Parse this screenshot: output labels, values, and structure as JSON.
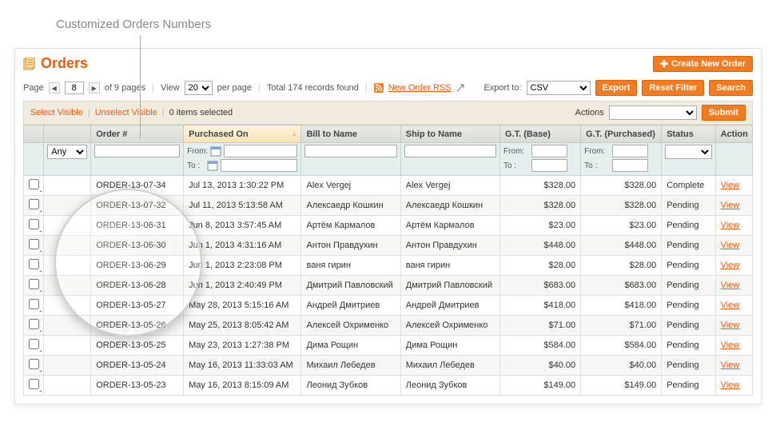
{
  "callout": "Customized Orders Numbers",
  "header": {
    "title": "Orders",
    "create_btn": "Create New Order"
  },
  "toolbar": {
    "page_label": "Page",
    "page_value": "8",
    "of_pages": "of 9 pages",
    "view_label": "View",
    "view_value": "20",
    "per_page": "per page",
    "total": "Total 174 records found",
    "rss": "New Order RSS",
    "export_label": "Export to:",
    "export_value": "CSV",
    "export_btn": "Export",
    "reset_btn": "Reset Filter",
    "search_btn": "Search"
  },
  "selectbar": {
    "select_visible": "Select Visible",
    "unselect_visible": "Unselect Visible",
    "items_selected": "0 items selected",
    "actions_label": "Actions",
    "submit": "Submit"
  },
  "columns": {
    "order_no": "Order #",
    "purchased_on": "Purchased On",
    "bill_to": "Bill to Name",
    "ship_to": "Ship to Name",
    "gt_base": "G.T. (Base)",
    "gt_purchased": "G.T. (Purchased)",
    "status": "Status",
    "action": "Action"
  },
  "filters": {
    "any": "Any",
    "from": "From:",
    "to": "To :"
  },
  "rows": [
    {
      "order": "ORDER-13-07-34",
      "date": "Jul 13, 2013 1:30:22 PM",
      "bill": "Alex Vergej",
      "ship": "Alex Vergej",
      "base": "$328.00",
      "purch": "$328.00",
      "status": "Complete"
    },
    {
      "order": "ORDER-13-07-32",
      "date": "Jul 11, 2013 5:13:58 AM",
      "bill": "Алексаедр Кошкин",
      "ship": "Алексаедр Кошкин",
      "base": "$328.00",
      "purch": "$328.00",
      "status": "Pending"
    },
    {
      "order": "ORDER-13-06-31",
      "date": "Jun 8, 2013 3:57:45 AM",
      "bill": "Артём Кармалов",
      "ship": "Артём Кармалов",
      "base": "$23.00",
      "purch": "$23.00",
      "status": "Pending"
    },
    {
      "order": "ORDER-13-06-30",
      "date": "Jun 1, 2013 4:31:16 AM",
      "bill": "Антон Правдухин",
      "ship": "Антон Правдухин",
      "base": "$448.00",
      "purch": "$448.00",
      "status": "Pending"
    },
    {
      "order": "ORDER-13-06-29",
      "date": "Jun 1, 2013 2:23:08 PM",
      "bill": "ваня гирин",
      "ship": "ваня гирин",
      "base": "$28.00",
      "purch": "$28.00",
      "status": "Pending"
    },
    {
      "order": "ORDER-13-06-28",
      "date": "Jun 1, 2013 2:40:49 PM",
      "bill": "Дмитрий Павловский",
      "ship": "Дмитрий Павловский",
      "base": "$683.00",
      "purch": "$683.00",
      "status": "Pending"
    },
    {
      "order": "ORDER-13-05-27",
      "date": "May 28, 2013 5:15:16 AM",
      "bill": "Андрей Дмитриев",
      "ship": "Андрей Дмитриев",
      "base": "$418.00",
      "purch": "$418.00",
      "status": "Pending"
    },
    {
      "order": "ORDER-13-05-26",
      "date": "May 25, 2013 8:05:42 AM",
      "bill": "Алексей Охрименко",
      "ship": "Алексей Охрименко",
      "base": "$71.00",
      "purch": "$71.00",
      "status": "Pending"
    },
    {
      "order": "ORDER-13-05-25",
      "date": "May 23, 2013 1:27:38 PM",
      "bill": "Дима Рощин",
      "ship": "Дима Рощин",
      "base": "$584.00",
      "purch": "$584.00",
      "status": "Pending"
    },
    {
      "order": "ORDER-13-05-24",
      "date": "May 16, 2013 11:33:03 AM",
      "bill": "Михаил Лебедев",
      "ship": "Михаил Лебедев",
      "base": "$40.00",
      "purch": "$40.00",
      "status": "Pending"
    },
    {
      "order": "ORDER-13-05-23",
      "date": "May 16, 2013 8:15:09 AM",
      "bill": "Леонид Зубков",
      "ship": "Леонид Зубков",
      "base": "$149.00",
      "purch": "$149.00",
      "status": "Pending"
    }
  ],
  "view_label": "View"
}
